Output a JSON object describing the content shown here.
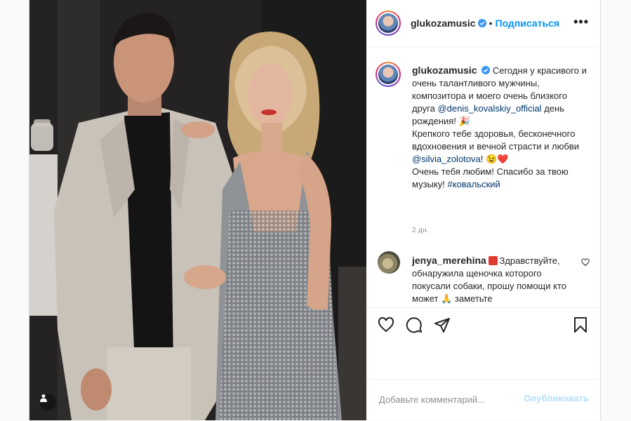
{
  "post": {
    "author": "glukozamusic",
    "follow_label": "Подписаться",
    "separator": "•",
    "more_label": "•••"
  },
  "caption": {
    "author": "glukozamusic",
    "text1": "Сегодня у красивого и очень талантливого мужчины, композитора и моего очень близкого друга",
    "mention1": "@denis_kovalskiy_official",
    "text2": "день рождения!",
    "emoji1": "🎉",
    "text3": "Крепкого тебе здоровья, бесконечного вдохновения и вечной страсти и любви",
    "mention2": "@silvia_zolotova",
    "text4": "!",
    "emoji2": "😉❤️",
    "text5": "Очень тебя любим! Спасибо за твою музыку!",
    "hashtag": "#ковальский",
    "time": "2 дн."
  },
  "comment": {
    "author": "jenya_merehina",
    "text": "Здравствуйте, обнаружила щеночка которого покусали собаки, прошу помощи кто может",
    "emoji": "🙏",
    "text_tail": "заметьте"
  },
  "add_comment": {
    "placeholder": "Добавьте комментарий...",
    "publish_label": "Опубликовать"
  },
  "icons": {
    "like": "heart-icon",
    "comment": "comment-icon",
    "share": "paper-plane-icon",
    "save": "bookmark-icon",
    "more": "more-options-icon",
    "tag": "user-tag-icon",
    "verified": "verified-badge-icon"
  },
  "colors": {
    "link": "#00376b",
    "follow": "#0095f6",
    "publish_disabled": "#b2dffc",
    "meta": "#8e8e8e"
  }
}
